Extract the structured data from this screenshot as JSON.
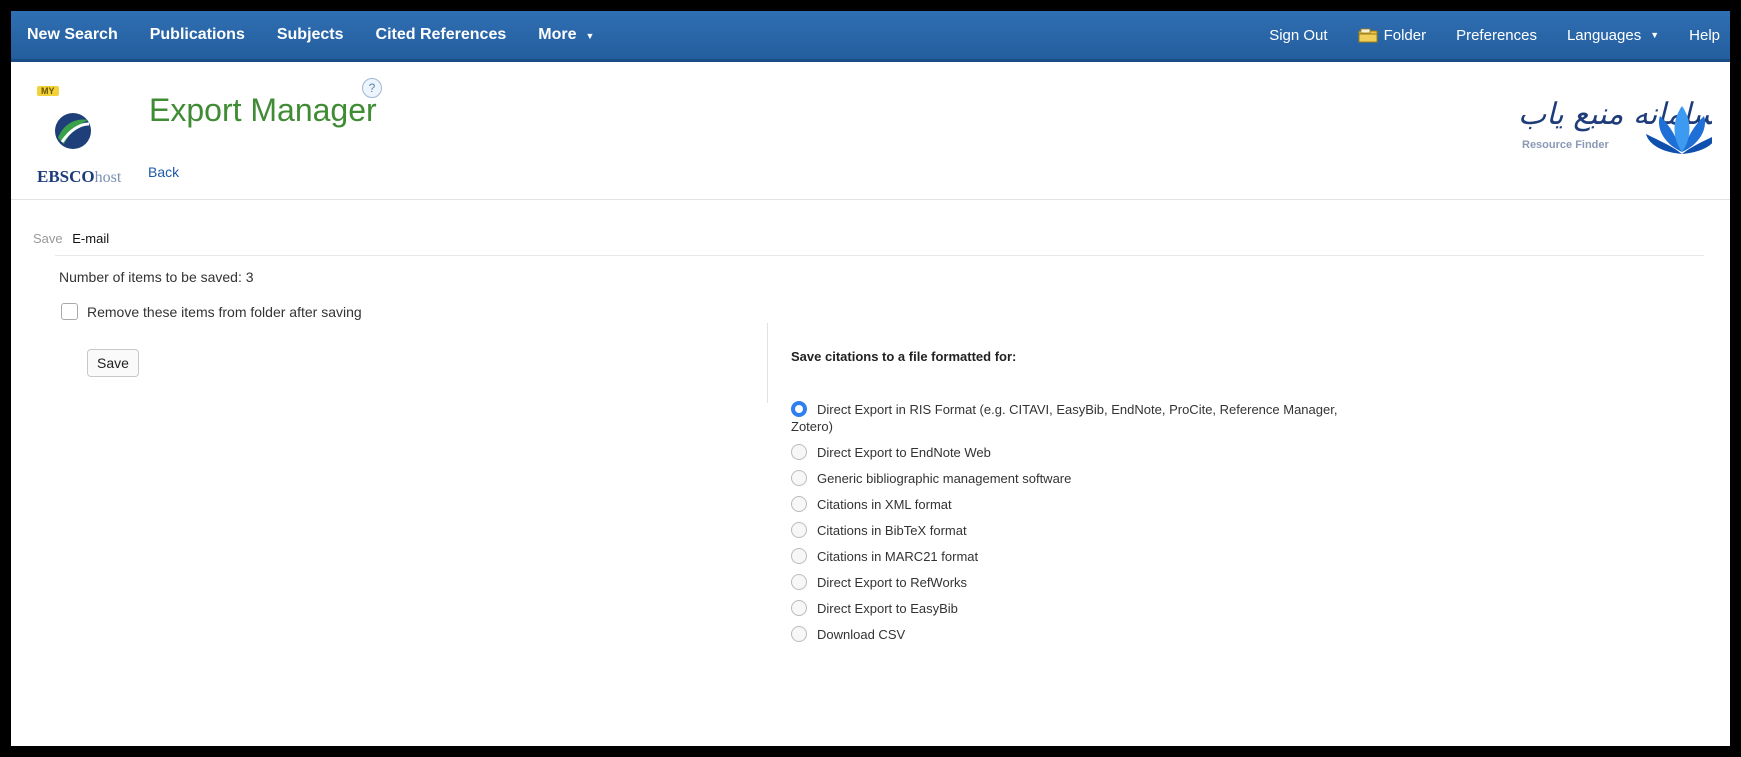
{
  "nav": {
    "left": [
      "New Search",
      "Publications",
      "Subjects",
      "Cited References",
      "More"
    ],
    "right": {
      "sign_out": "Sign Out",
      "folder": "Folder",
      "preferences": "Preferences",
      "languages": "Languages",
      "help": "Help"
    }
  },
  "header": {
    "my_badge": "MY",
    "brand": "EBSCO",
    "brand_suffix": "host",
    "title": "Export Manager",
    "help_symbol": "?",
    "back": "Back",
    "partner_logo_alt": "سامانه منبع یاب",
    "partner_logo_sub": "Resource Finder"
  },
  "tabs": {
    "save": "Save",
    "email": "E-mail"
  },
  "left": {
    "items_count": "Number of items to be saved: 3",
    "remove_label": "Remove these items from folder after saving",
    "remove_checked": false,
    "save_button": "Save"
  },
  "right": {
    "heading": "Save citations to a file formatted for:",
    "options": [
      {
        "label": "Direct Export in RIS Format (e.g. CITAVI, EasyBib, EndNote, ProCite, Reference Manager, Zotero)",
        "checked": true
      },
      {
        "label": "Direct Export to EndNote Web",
        "checked": false
      },
      {
        "label": "Generic bibliographic management software",
        "checked": false
      },
      {
        "label": "Citations in XML format",
        "checked": false
      },
      {
        "label": "Citations in BibTeX format",
        "checked": false
      },
      {
        "label": "Citations in MARC21 format",
        "checked": false
      },
      {
        "label": "Direct Export to RefWorks",
        "checked": false
      },
      {
        "label": "Direct Export to EasyBib",
        "checked": false
      },
      {
        "label": "Download CSV",
        "checked": false
      }
    ]
  },
  "colors": {
    "nav_bg": "#2b6cb0",
    "title_green": "#3f8c34",
    "link_blue": "#1d5aa8",
    "radio_selected": "#2f7ff0"
  }
}
